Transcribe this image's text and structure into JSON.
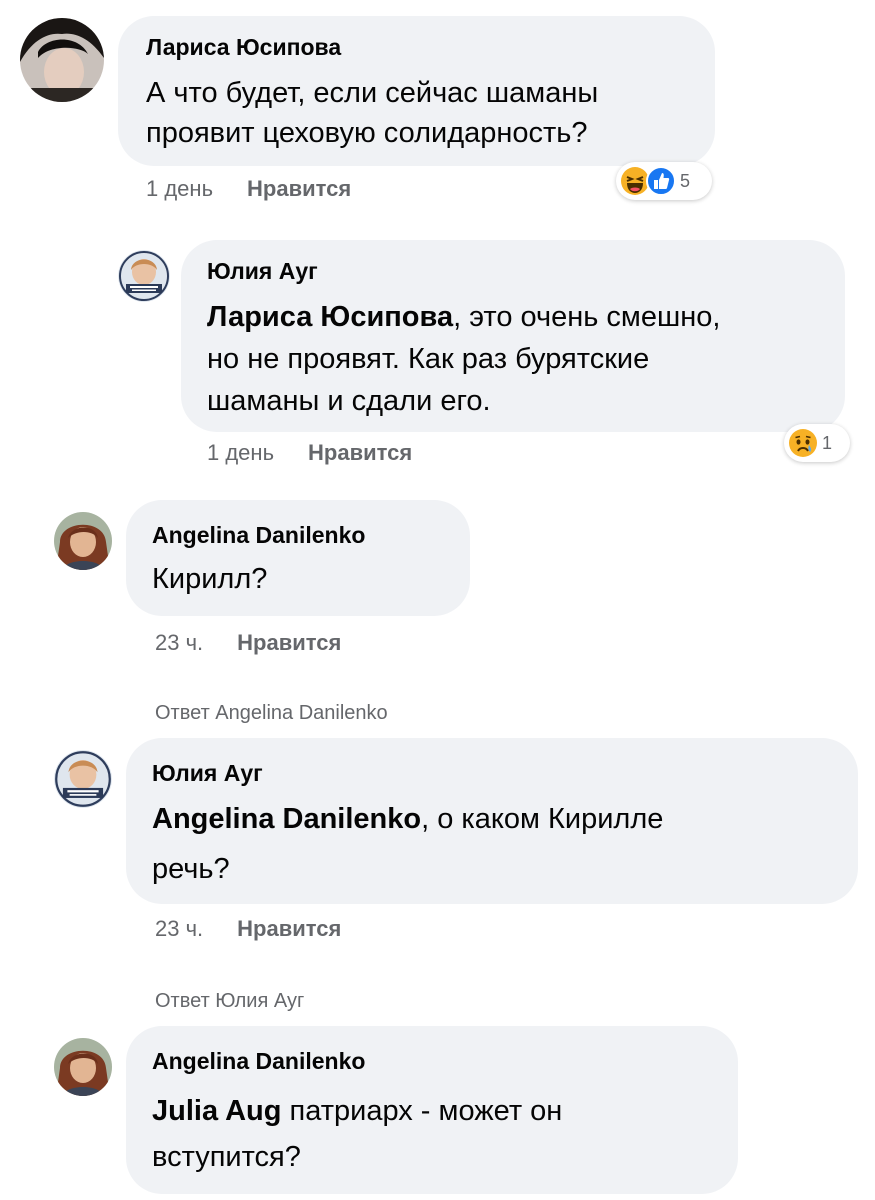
{
  "comments": [
    {
      "author": "Лариса Юсипова",
      "lines": [
        "А что будет, если сейчас шаманы",
        "проявит цеховую солидарность?"
      ],
      "time": "1 день",
      "like": "Нравится",
      "reactions": [
        "haha-icon",
        "like-icon"
      ],
      "reaction_count": "5"
    },
    {
      "author": "Юлия Ауг",
      "mention": "Лариса Юсипова",
      "lines": [
        "это очень смешно,",
        "но не проявят. Как раз бурятские",
        "шаманы и сдали его."
      ],
      "time": "1 день",
      "like": "Нравится",
      "reactions": [
        "sad-icon"
      ],
      "reaction_count": "1"
    },
    {
      "author": "Angelina Danilenko",
      "lines": [
        "Кирилл?"
      ],
      "time": "23 ч.",
      "like": "Нравится"
    },
    {
      "reply_to": "Ответ Angelina Danilenko",
      "author": "Юлия Ауг",
      "mention": "Angelina Danilenko",
      "lines": [
        ", о каком Кирилле",
        "речь?"
      ],
      "time": "23 ч.",
      "like": "Нравится"
    },
    {
      "reply_to": "Ответ Юлия Ауг",
      "author": "Angelina Danilenko",
      "mention": "Julia Aug",
      "lines": [
        "патриарх - может он",
        "вступится?"
      ]
    }
  ],
  "colors": {
    "bubble": "#f0f2f5",
    "meta_text": "#65676b",
    "like_blue": "#1877f2",
    "emoji_yellow": "#f7b125"
  }
}
